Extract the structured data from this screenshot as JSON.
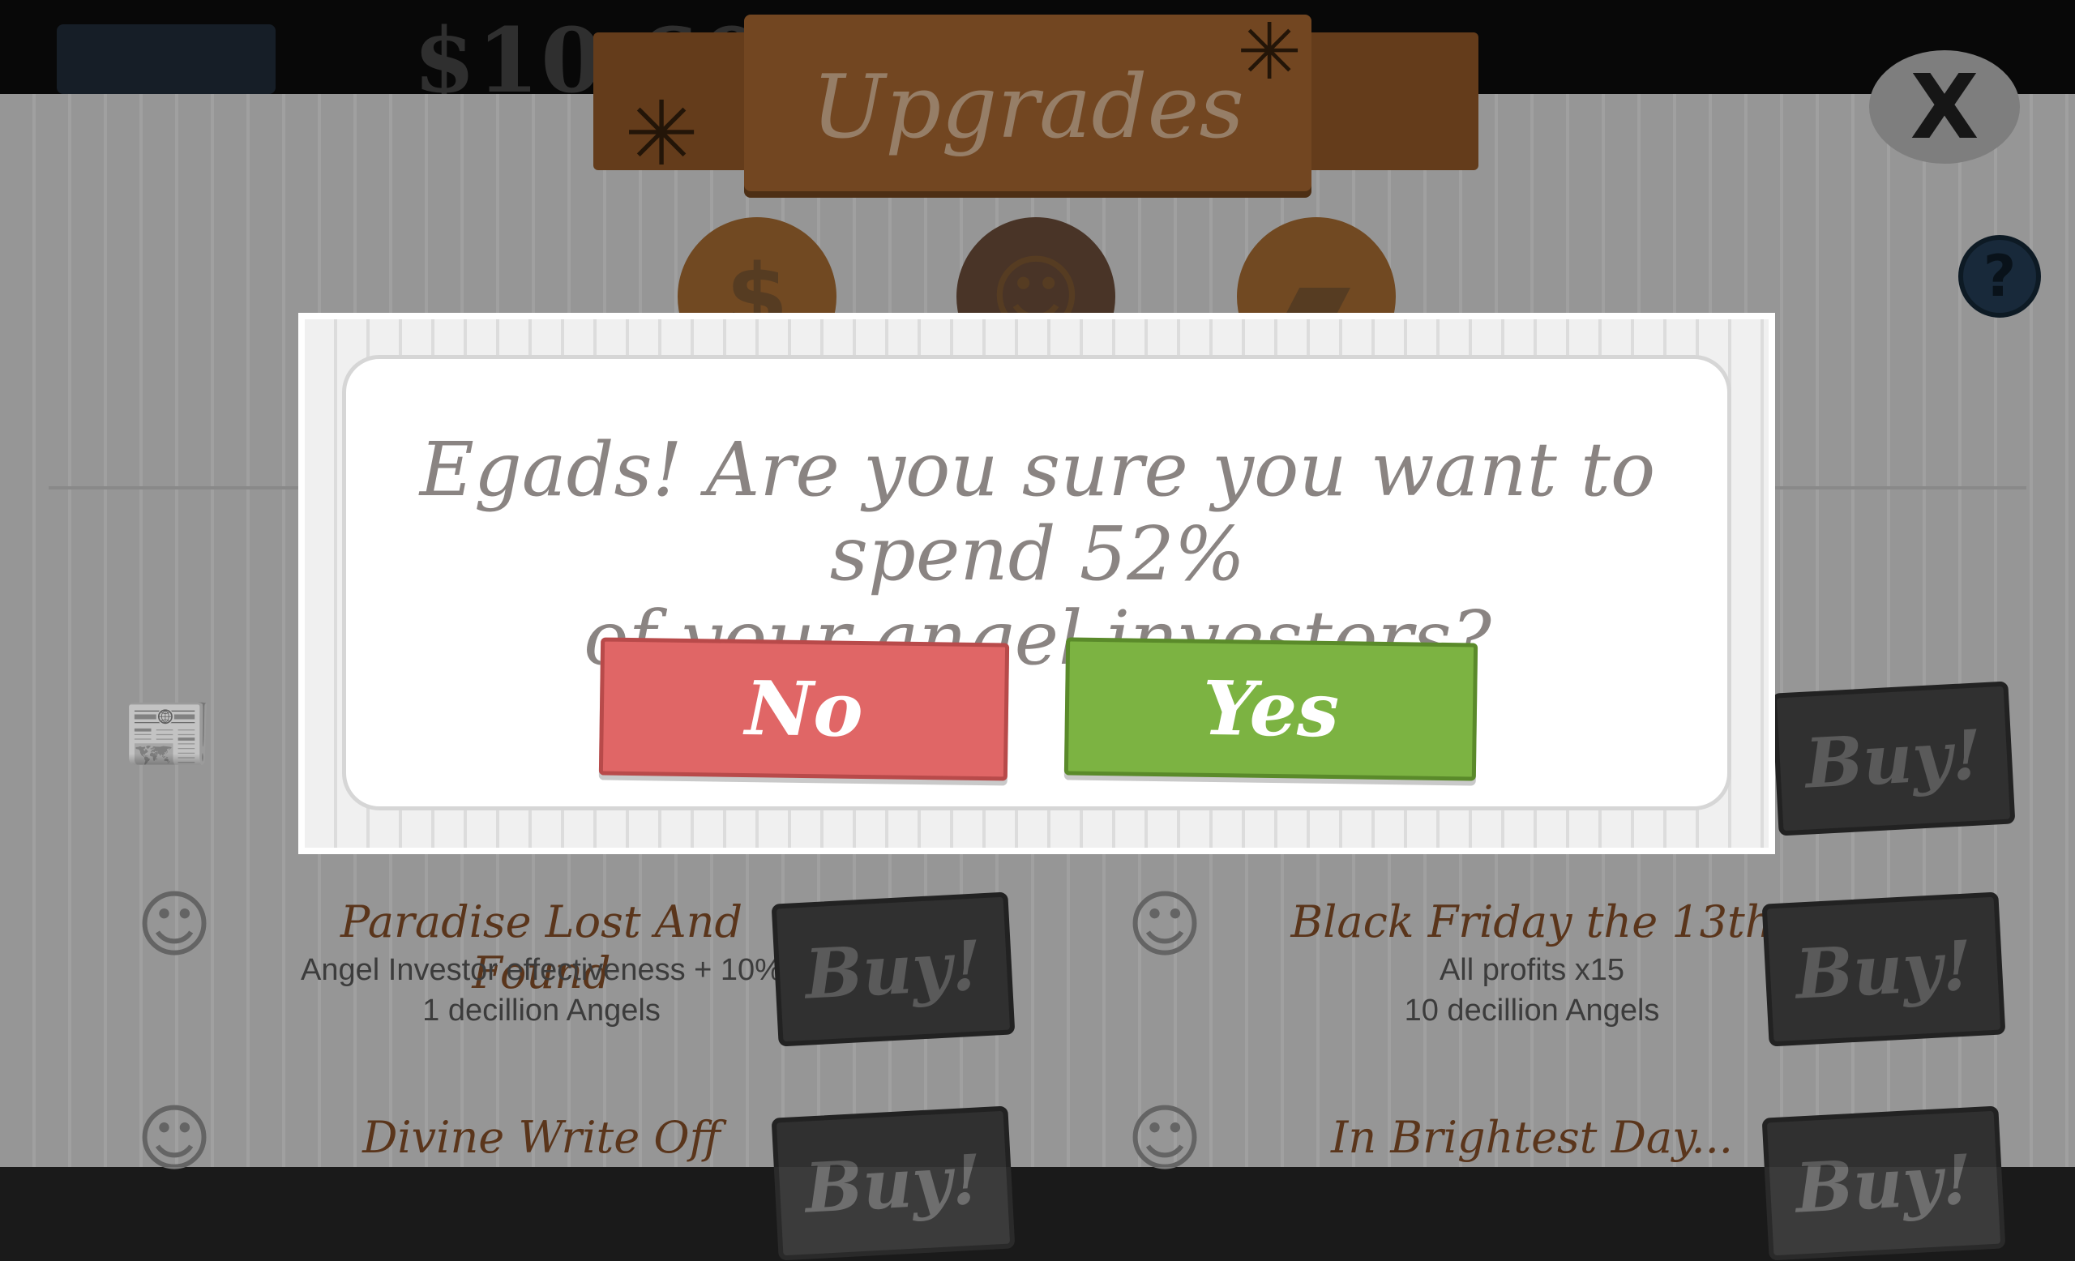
{
  "header": {
    "money": "$10,60",
    "title": "Upgrades",
    "close_label": "X",
    "help_label": "?"
  },
  "tabs": [
    {
      "icon": "dollar-icon",
      "glyph": "$"
    },
    {
      "icon": "angel-icon",
      "glyph": "☺"
    },
    {
      "icon": "gold-bars-icon",
      "glyph": "▰"
    }
  ],
  "upgrades": [
    {
      "title": "Paradise Lost And Found",
      "desc": "Angel Investor effectiveness + 10%",
      "cost": "1 decillion Angels",
      "buy": "Buy!"
    },
    {
      "title": "Black Friday the 13th",
      "desc": "All profits x15",
      "cost": "10 decillion Angels",
      "buy": "Buy!"
    },
    {
      "title": "Divine Write Off",
      "desc": "",
      "cost": "",
      "buy": "Buy!"
    },
    {
      "title": "In Brightest Day...",
      "desc": "",
      "cost": "",
      "buy": "Buy!"
    }
  ],
  "partial_buy": "Buy!",
  "dialog": {
    "message_line1": "Egads! Are you sure you want to spend 52%",
    "message_line2": "of your angel investors?",
    "no_label": "No",
    "yes_label": "Yes"
  },
  "colors": {
    "no_button": "#e06666",
    "yes_button": "#7cb342",
    "banner": "#8c5629",
    "title_text": "#6e4122"
  }
}
